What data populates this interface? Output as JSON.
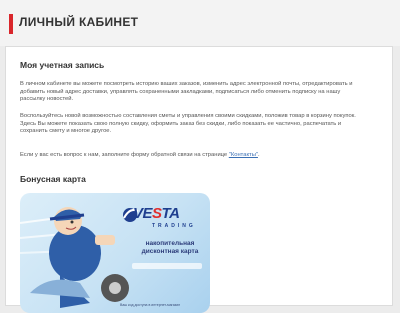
{
  "page": {
    "title": "ЛИЧНЫЙ КАБИНЕТ"
  },
  "account": {
    "heading": "Моя учетная запись",
    "p1": "В личном кабинете вы можете посмотреть историю ваших заказов, изменить адрес электронной почты, отредактировать и добавить новый адрес доставки, управлять сохраненными закладками, подписаться либо отменить подписку на нашу рассылку новостей.",
    "p2": "Воспользуйтесь новой возможностью составления сметы и управления своими скидками, положив товар в корзину покупок. Здесь Вы можете показать свою полную скидку, оформить заказ без скидки, либо показать ее частично, распечатать и сохранить смету и многое другое.",
    "p3_prefix": "Если у вас есть вопрос к нам, заполните форму обратной связи на странице ",
    "p3_link": "\"Контакты\"",
    "p3_suffix": "."
  },
  "bonus": {
    "heading": "Бонусная карта",
    "brand_a": "VE",
    "brand_b": "S",
    "brand_c": "TA",
    "brand_sub": "TRADING",
    "card_line1": "накопительная",
    "card_line2": "дисконтная карта",
    "footer": "Ваш код доступа в интернет-магазин"
  },
  "colors": {
    "accent": "#d9262b",
    "brand_blue": "#1f3f8f",
    "link": "#3a6fb4"
  }
}
